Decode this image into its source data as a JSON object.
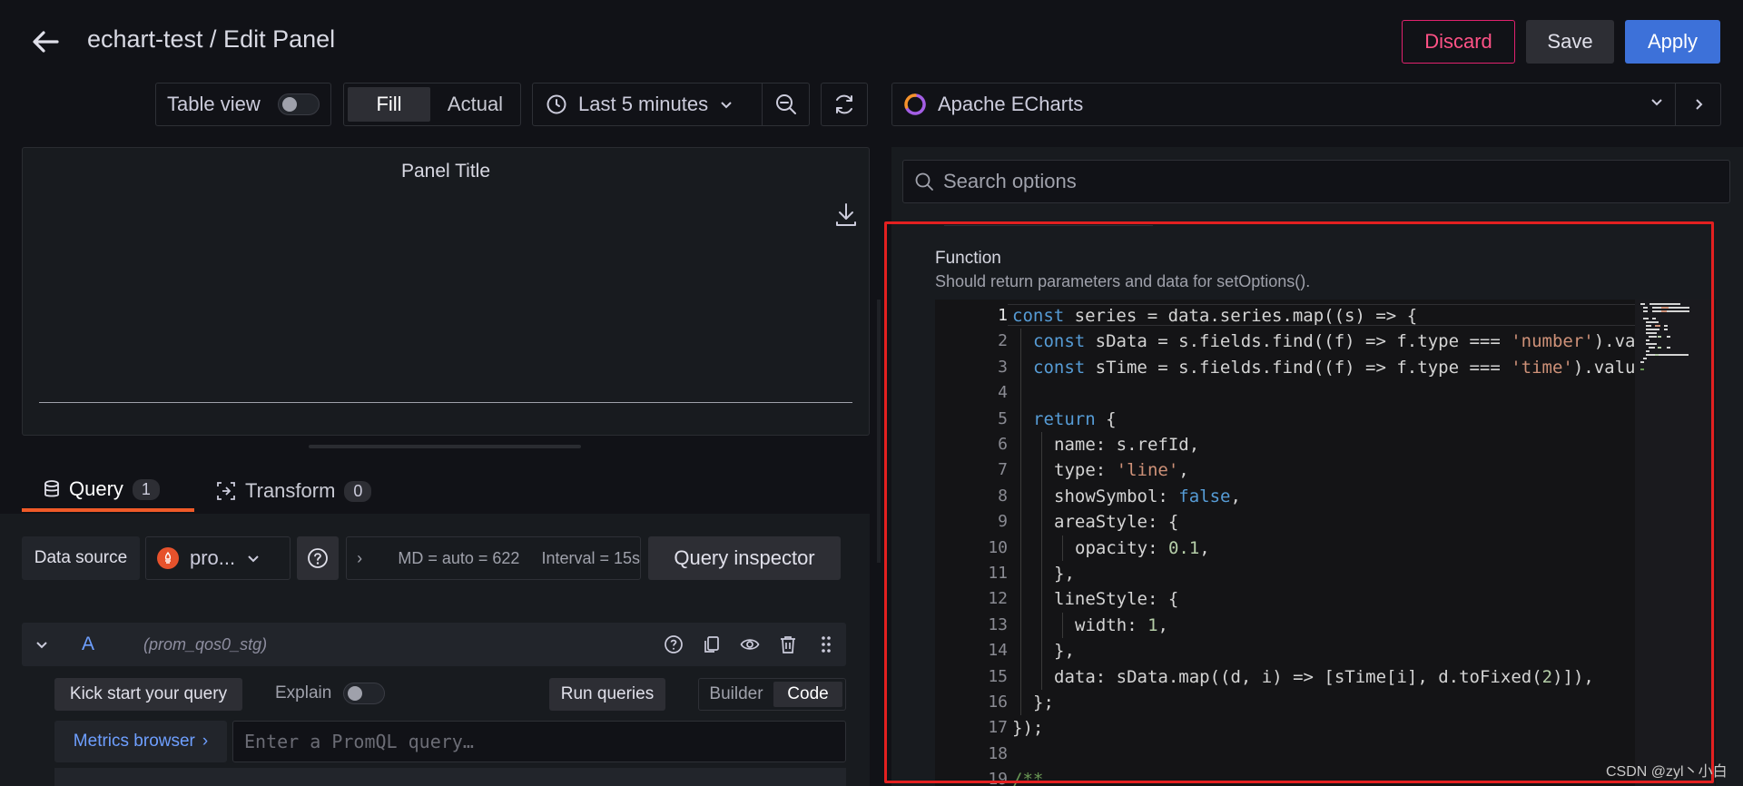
{
  "header": {
    "title": "echart-test / Edit Panel",
    "discard_label": "Discard",
    "save_label": "Save",
    "apply_label": "Apply"
  },
  "toolbar": {
    "table_view_label": "Table view",
    "fill_label": "Fill",
    "actual_label": "Actual",
    "time_range_label": "Last 5 minutes"
  },
  "panel": {
    "title": "Panel Title"
  },
  "query_tabs": [
    {
      "label": "Query",
      "count": "1"
    },
    {
      "label": "Transform",
      "count": "0"
    }
  ],
  "data_source": {
    "label": "Data source",
    "selected": "pro...",
    "options_text": "MD = auto = 622",
    "interval_text": "Interval = 15s",
    "inspector_label": "Query inspector"
  },
  "query": {
    "ref_id": "A",
    "datasource_name": "(prom_qos0_stg)",
    "kick_start_label": "Kick start your query",
    "explain_label": "Explain",
    "run_label": "Run queries",
    "builder_label": "Builder",
    "code_label": "Code",
    "metrics_browser_label": "Metrics browser",
    "promql_placeholder": "Enter a PromQL query…"
  },
  "options_pane": {
    "visualization": "Apache ECharts",
    "search_placeholder": "Search options",
    "function_label": "Function",
    "function_desc": "Should return parameters and data for setOptions()."
  },
  "editor": {
    "current_line": 1,
    "lines": [
      {
        "n": "1",
        "indent": 0,
        "tokens": [
          [
            "kw",
            "const"
          ],
          [
            "txt",
            " series = data.series.map((s) => {"
          ]
        ]
      },
      {
        "n": "2",
        "indent": 1,
        "tokens": [
          [
            "kw",
            "const"
          ],
          [
            "txt",
            " sData = s.fields.find((f) => f.type === "
          ],
          [
            "str",
            "'number'"
          ],
          [
            "txt",
            ").va"
          ]
        ]
      },
      {
        "n": "3",
        "indent": 1,
        "tokens": [
          [
            "kw",
            "const"
          ],
          [
            "txt",
            " sTime = s.fields.find((f) => f.type === "
          ],
          [
            "str",
            "'time'"
          ],
          [
            "txt",
            ").valu"
          ]
        ]
      },
      {
        "n": "4",
        "indent": 1,
        "tokens": []
      },
      {
        "n": "5",
        "indent": 1,
        "tokens": [
          [
            "kw",
            "return"
          ],
          [
            "txt",
            " {"
          ]
        ]
      },
      {
        "n": "6",
        "indent": 2,
        "tokens": [
          [
            "txt",
            "name: s.refId,"
          ]
        ]
      },
      {
        "n": "7",
        "indent": 2,
        "tokens": [
          [
            "txt",
            "type: "
          ],
          [
            "str",
            "'line'"
          ],
          [
            "txt",
            ","
          ]
        ]
      },
      {
        "n": "8",
        "indent": 2,
        "tokens": [
          [
            "txt",
            "showSymbol: "
          ],
          [
            "kw",
            "false"
          ],
          [
            "txt",
            ","
          ]
        ]
      },
      {
        "n": "9",
        "indent": 2,
        "tokens": [
          [
            "txt",
            "areaStyle: {"
          ]
        ]
      },
      {
        "n": "10",
        "indent": 3,
        "tokens": [
          [
            "txt",
            "opacity: "
          ],
          [
            "num",
            "0.1"
          ],
          [
            "txt",
            ","
          ]
        ]
      },
      {
        "n": "11",
        "indent": 2,
        "tokens": [
          [
            "txt",
            "},"
          ]
        ]
      },
      {
        "n": "12",
        "indent": 2,
        "tokens": [
          [
            "txt",
            "lineStyle: {"
          ]
        ]
      },
      {
        "n": "13",
        "indent": 3,
        "tokens": [
          [
            "txt",
            "width: "
          ],
          [
            "num",
            "1"
          ],
          [
            "txt",
            ","
          ]
        ]
      },
      {
        "n": "14",
        "indent": 2,
        "tokens": [
          [
            "txt",
            "},"
          ]
        ]
      },
      {
        "n": "15",
        "indent": 2,
        "tokens": [
          [
            "txt",
            "data: sData.map((d, i) => [sTime[i], d.toFixed("
          ],
          [
            "num",
            "2"
          ],
          [
            "txt",
            ")]),"
          ]
        ]
      },
      {
        "n": "16",
        "indent": 1,
        "tokens": [
          [
            "txt",
            "};"
          ]
        ]
      },
      {
        "n": "17",
        "indent": 0,
        "tokens": [
          [
            "txt",
            "});"
          ]
        ]
      },
      {
        "n": "18",
        "indent": 0,
        "tokens": []
      },
      {
        "n": "19",
        "indent": 0,
        "tokens": [
          [
            "cmt",
            "/**"
          ]
        ]
      }
    ]
  },
  "watermark": "CSDN @zyl丶小白",
  "colors": {
    "accent_blue": "#3d71d9",
    "discard_pink": "#ff5286",
    "tab_underline": "#f05a28",
    "highlight_box": "#e32020"
  }
}
